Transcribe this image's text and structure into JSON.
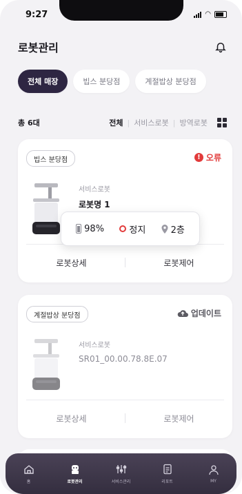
{
  "status": {
    "time": "9:27"
  },
  "header": {
    "title": "로봇관리"
  },
  "chips": [
    "전체 매장",
    "빕스 분당점",
    "계절밥상 분당점"
  ],
  "filter_row": {
    "count": "총 6대",
    "filters": [
      "전체",
      "서비스로봇",
      "방역로봇"
    ]
  },
  "robots": [
    {
      "store": "빕스 분당점",
      "state": "오류",
      "type": "서비스로봇",
      "name": "로봇명 1",
      "detail_label": "로봇상세",
      "control_label": "로봇제어"
    },
    {
      "store": "계절밥상 분당점",
      "state": "업데이트",
      "type": "서비스로봇",
      "name": "SR01_00.00.78.8E.07",
      "detail_label": "로봇상세",
      "control_label": "로봇제어"
    }
  ],
  "popup": {
    "battery": "98%",
    "status": "정지",
    "floor": "2층"
  },
  "tabs": [
    {
      "label": "홈",
      "icon": "home-icon"
    },
    {
      "label": "로봇관리",
      "icon": "robot-icon"
    },
    {
      "label": "서비스관리",
      "icon": "sliders-icon"
    },
    {
      "label": "리포트",
      "icon": "report-icon"
    },
    {
      "label": "MY",
      "icon": "user-icon"
    }
  ],
  "colors": {
    "accent": "#2e2642",
    "error": "#e23b3b",
    "tabbar": "#3d3649"
  }
}
